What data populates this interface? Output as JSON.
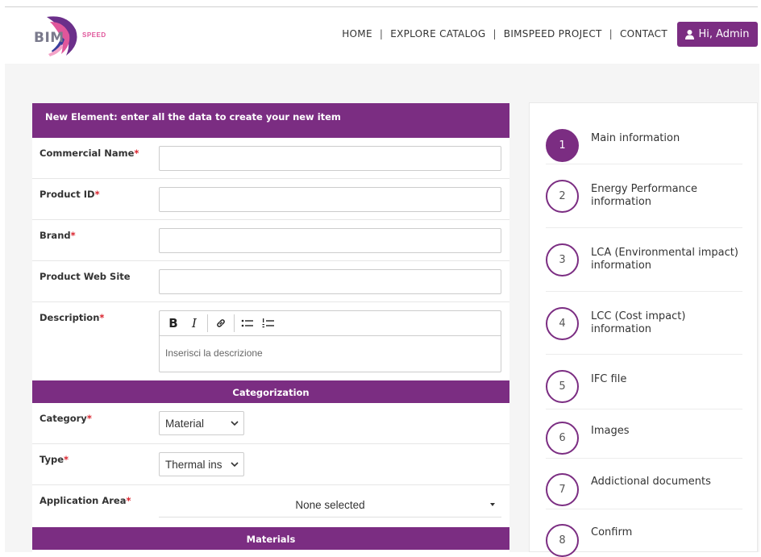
{
  "header": {
    "logo_main": "BIM",
    "logo_sub": "SPEED",
    "nav": [
      "HOME",
      "EXPLORE CATALOG",
      "BIMSPEED PROJECT",
      "CONTACT"
    ],
    "nav_separator": "|",
    "user_button": "Hi, Admin",
    "user_icon": "user-icon"
  },
  "form": {
    "title": "New Element: enter all the data to create your new item",
    "required_mark": "*",
    "fields": {
      "commercial_name": "Commercial Name",
      "product_id": "Product ID",
      "brand": "Brand",
      "web_site": "Product Web Site",
      "description": "Description"
    },
    "editor": {
      "bold": "B",
      "italic": "I",
      "placeholder": "Inserisci la descrizione"
    },
    "categorization": {
      "title": "Categorization",
      "category_label": "Category",
      "category_value": "Material",
      "type_label": "Type",
      "type_value": "Thermal ins",
      "application_label": "Application Area",
      "application_value": "None selected"
    },
    "materials_title": "Materials"
  },
  "steps": [
    {
      "num": "1",
      "label": "Main information",
      "active": true
    },
    {
      "num": "2",
      "label": "Energy Performance information",
      "active": false
    },
    {
      "num": "3",
      "label": "LCA (Environmental impact) information",
      "active": false
    },
    {
      "num": "4",
      "label": "LCC (Cost impact) information",
      "active": false
    },
    {
      "num": "5",
      "label": "IFC file",
      "active": false
    },
    {
      "num": "6",
      "label": "Images",
      "active": false
    },
    {
      "num": "7",
      "label": "Addictional documents",
      "active": false
    },
    {
      "num": "8",
      "label": "Confirm",
      "active": false
    }
  ],
  "colors": {
    "accent": "#7b2d82",
    "required": "#d9232d",
    "logo_pink": "#e0569b"
  }
}
